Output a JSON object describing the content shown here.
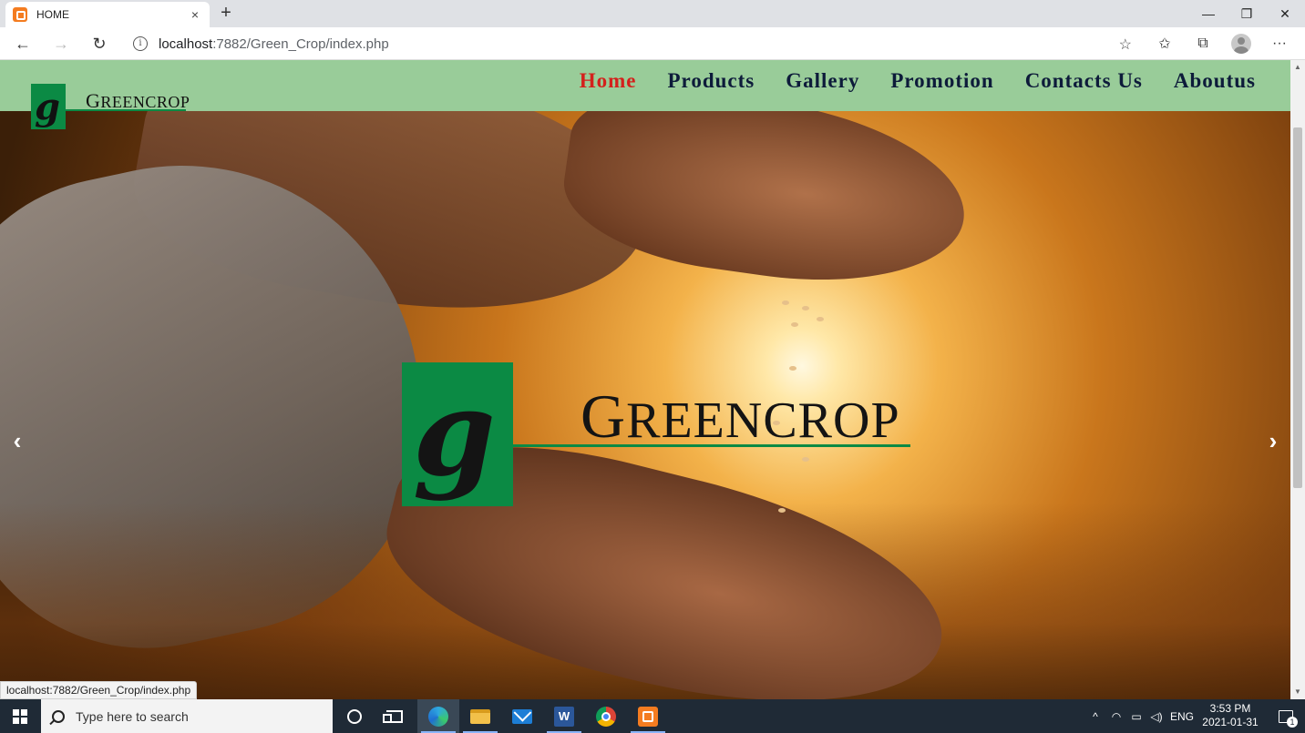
{
  "browser": {
    "tab_title": "HOME",
    "tab_close": "×",
    "new_tab": "+",
    "url_host": "localhost",
    "url_path": ":7882/Green_Crop/index.php",
    "status_url": "localhost:7882/Green_Crop/index.php",
    "window_controls": {
      "minimize": "—",
      "restore": "❐",
      "close": "✕"
    },
    "nav_icons": {
      "back": "←",
      "forward": "→",
      "reload": "↻",
      "info": "i",
      "favorite": "☆",
      "favorites_bar": "✩",
      "collections": "⧉",
      "menu": "···"
    }
  },
  "header": {
    "logo_letter": "g",
    "logo_text_first": "G",
    "logo_text_rest": "REENCROP",
    "nav": [
      {
        "label": "Home",
        "active": true
      },
      {
        "label": "Products",
        "active": false
      },
      {
        "label": "Gallery",
        "active": false
      },
      {
        "label": "Promotion",
        "active": false
      },
      {
        "label": "Contacts Us",
        "active": false
      },
      {
        "label": "Aboutus",
        "active": false
      }
    ]
  },
  "hero": {
    "logo_letter": "g",
    "logo_text_first": "G",
    "logo_text_rest": "REENCROP",
    "prev_arrow": "‹",
    "next_arrow": "›"
  },
  "taskbar": {
    "search_placeholder": "Type here to search",
    "apps": [
      "cortana-icon",
      "task-view-icon",
      "edge-icon",
      "file-explorer-icon",
      "mail-icon",
      "word-icon",
      "chrome-icon",
      "xampp-icon"
    ],
    "word_letter": "W",
    "tray_chevron": "^",
    "language": "ENG",
    "time": "3:53 PM",
    "date": "2021-01-31",
    "notification_count": "1"
  },
  "colors": {
    "header_bg": "#99cc99",
    "nav_text": "#0d1b3a",
    "nav_active": "#d4201c",
    "logo_green": "#0b8a44",
    "taskbar_bg": "#1f2a36"
  }
}
